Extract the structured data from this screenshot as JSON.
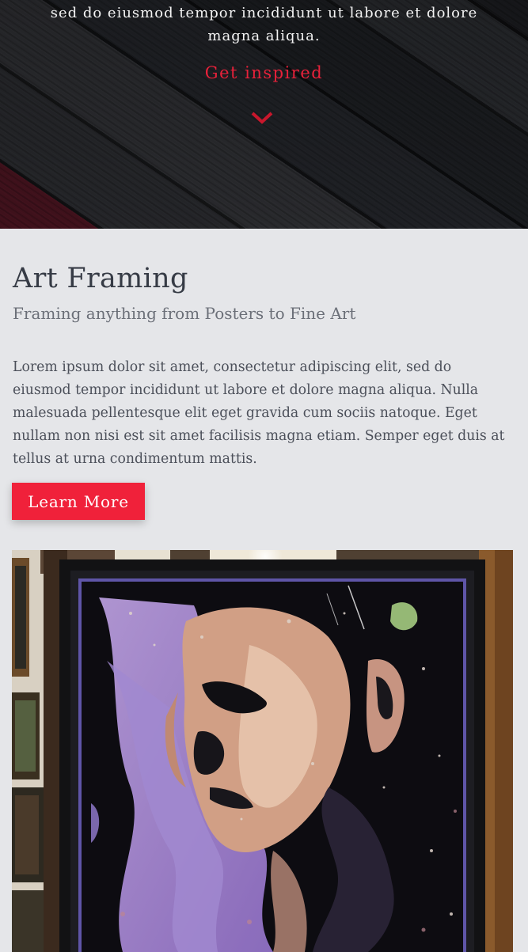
{
  "hero": {
    "text": "sed do eiusmod tempor incididunt ut labore et dolore magna aliqua.",
    "cta_label": "Get inspired",
    "chevron_icon": "chevron-down-icon",
    "accent_color": "#e8213a"
  },
  "section": {
    "title": "Art Framing",
    "subtitle": "Framing anything from Posters to Fine Art",
    "body": "Lorem ipsum dolor sit amet, consectetur adipiscing elit, sed do eiusmod tempor incididunt ut labore et dolore magna aliqua. Nulla malesuada pellentesque elit eget gravida cum sociis natoque. Eget nullam non nisi est sit amet facilisis magna etiam. Semper eget duis at tellus at urna condimentum mattis.",
    "button_label": "Learn More",
    "button_color": "#f0213a"
  },
  "colors": {
    "page_background": "#e5e6e9",
    "title_text": "#363b45",
    "body_text": "#4c505a"
  }
}
